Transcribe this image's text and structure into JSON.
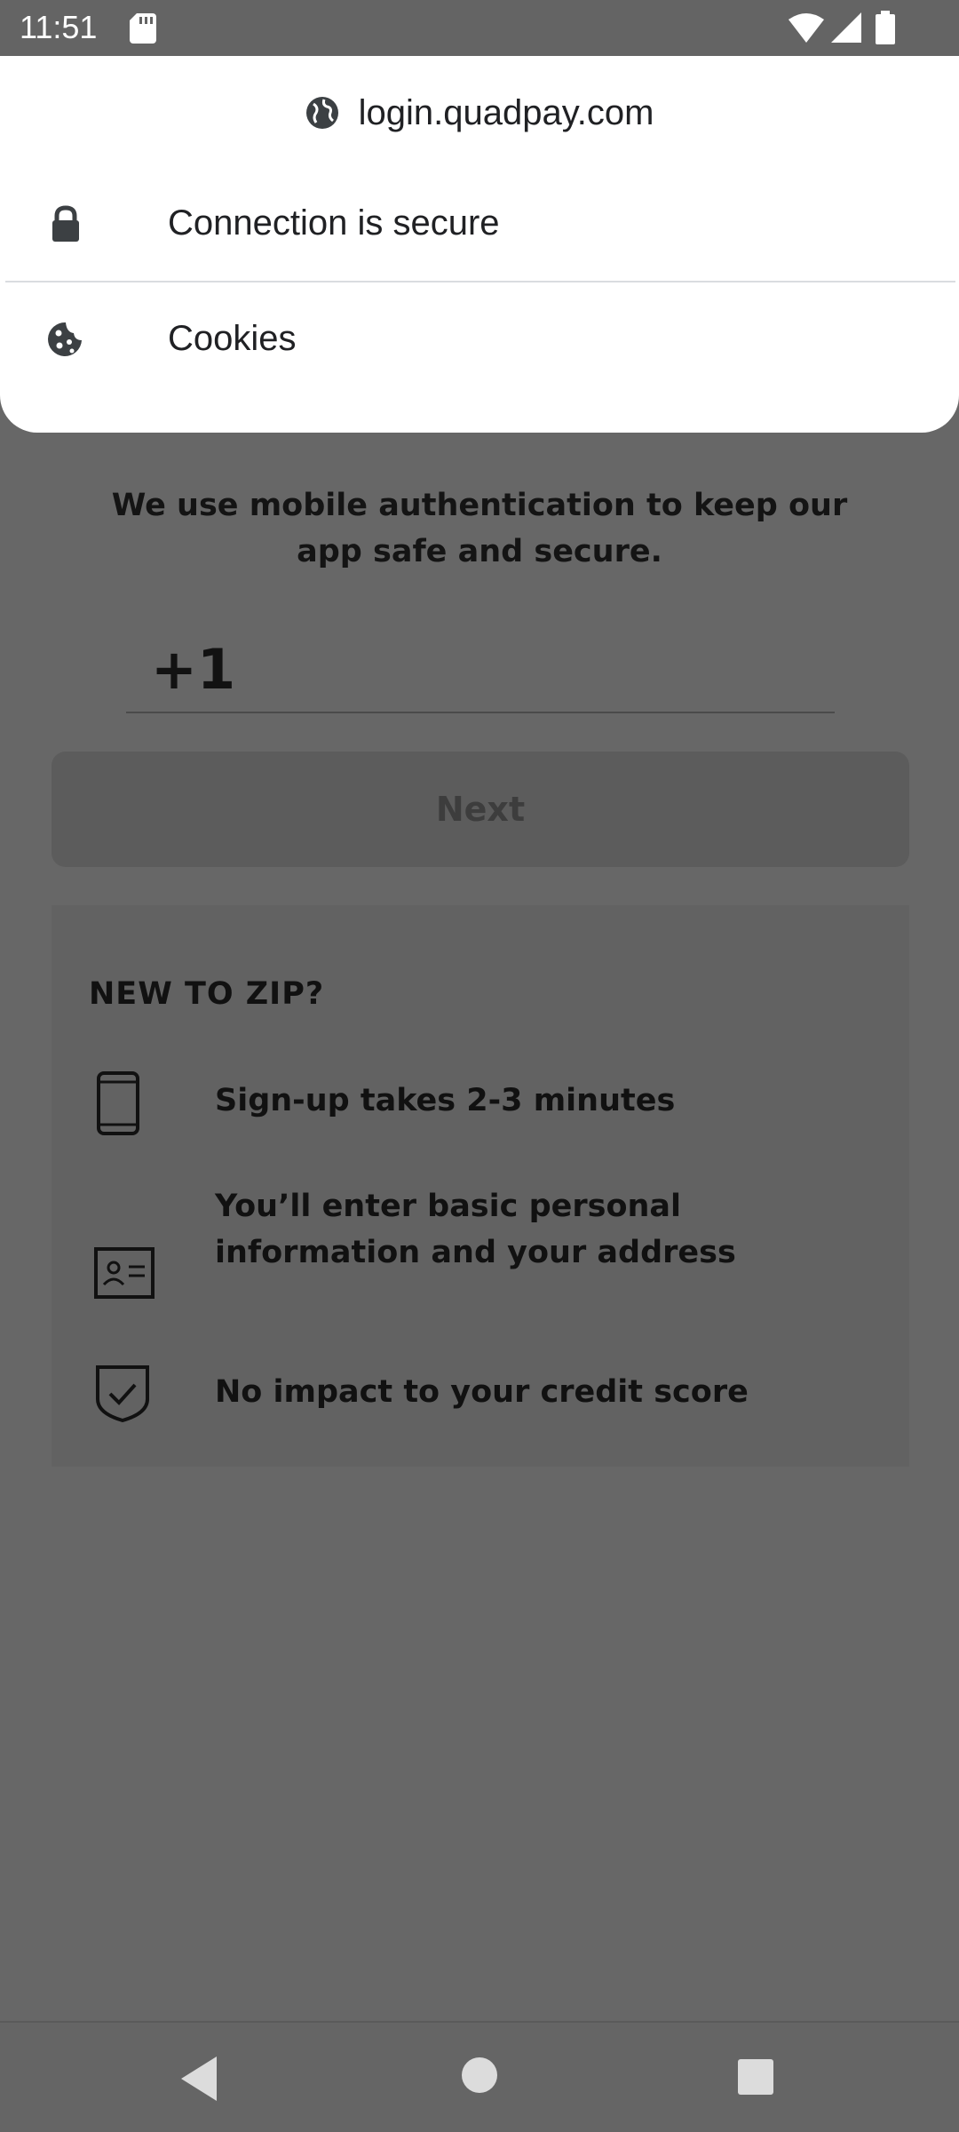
{
  "status_bar": {
    "time": "11:51",
    "icons": [
      "sd-card-icon",
      "wifi-icon",
      "signal-icon",
      "battery-icon"
    ]
  },
  "popup": {
    "url": "login.quadpay.com",
    "url_icon": "globe-icon",
    "rows": [
      {
        "label": "Connection is secure",
        "icon": "lock-icon"
      },
      {
        "label": "Cookies",
        "icon": "cookie-icon"
      }
    ]
  },
  "page": {
    "auth_text": "We use mobile authentication to keep our app safe and secure.",
    "phone_prefix": "+1",
    "next_label": "Next",
    "new_heading": "NEW TO ZIP?",
    "features": [
      {
        "text": "Sign-up takes 2-3 minutes",
        "icon": "phone-icon"
      },
      {
        "text": "You’ll enter basic personal information and your address",
        "icon": "id-card-icon"
      },
      {
        "text": "No impact to your credit score",
        "icon": "shield-check-icon"
      }
    ]
  },
  "nav_bar": {
    "buttons": [
      "back-icon",
      "home-icon",
      "recents-icon"
    ]
  },
  "colors": {
    "overlay_background": "#676767",
    "popup_background": "#ffffff",
    "popup_text": "#202124"
  }
}
